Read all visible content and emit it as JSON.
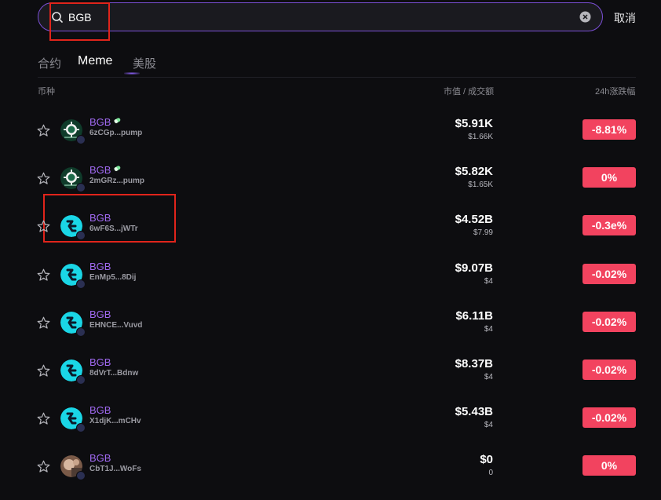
{
  "search": {
    "value": "BGB",
    "placeholder": ""
  },
  "cancel_label": "取消",
  "tabs": [
    {
      "label": "合约",
      "active": false
    },
    {
      "label": "Meme",
      "active": true
    },
    {
      "label": "美股",
      "active": false
    }
  ],
  "headers": {
    "coin": "币种",
    "mcap_volume": "市值 / 成交额",
    "change": "24h涨跌幅"
  },
  "colors": {
    "accent": "#a16af2",
    "negative": "#f2435f",
    "search_border": "#7b4fd6",
    "highlight": "#e0241b"
  },
  "rows": [
    {
      "name": "BGB",
      "address": "6zCGp...pump",
      "mcap": "$5.91K",
      "volume": "$1.66K",
      "change": "-8.81%",
      "avatar": "casino-chip-icon",
      "badge": "pill-icon"
    },
    {
      "name": "BGB",
      "address": "2mGRz...pump",
      "mcap": "$5.82K",
      "volume": "$1.65K",
      "change": "0%",
      "avatar": "casino-chip-icon",
      "badge": "pill-icon"
    },
    {
      "name": "BGB",
      "address": "6wF6S...jWTr",
      "mcap": "$4.52B",
      "volume": "$7.99",
      "change": "-0.3e%",
      "avatar": "bitget-logo-icon",
      "badge": ""
    },
    {
      "name": "BGB",
      "address": "EnMp5...8Dij",
      "mcap": "$9.07B",
      "volume": "$4",
      "change": "-0.02%",
      "avatar": "bitget-logo-icon",
      "badge": ""
    },
    {
      "name": "BGB",
      "address": "EHNCE...Vuvd",
      "mcap": "$6.11B",
      "volume": "$4",
      "change": "-0.02%",
      "avatar": "bitget-logo-icon",
      "badge": ""
    },
    {
      "name": "BGB",
      "address": "8dVrT...Bdnw",
      "mcap": "$8.37B",
      "volume": "$4",
      "change": "-0.02%",
      "avatar": "bitget-logo-icon",
      "badge": ""
    },
    {
      "name": "BGB",
      "address": "X1djK...mCHv",
      "mcap": "$5.43B",
      "volume": "$4",
      "change": "-0.02%",
      "avatar": "bitget-logo-icon",
      "badge": ""
    },
    {
      "name": "BGB",
      "address": "CbT1J...WoFs",
      "mcap": "$0",
      "volume": "0",
      "change": "0%",
      "avatar": "photo-avatar",
      "badge": ""
    }
  ]
}
